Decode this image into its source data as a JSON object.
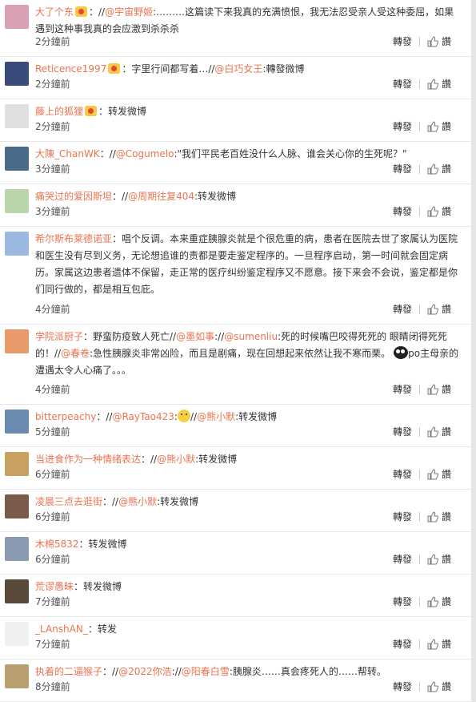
{
  "repost_label": "轉發",
  "like_label": "讚",
  "comments": [
    {
      "name": "大了个东",
      "badge": true,
      "parts": [
        {
          "t": "：//"
        },
        {
          "t": "@宇宙野姬",
          "m": true
        },
        {
          "t": ":………这篇读下来我真的充满愤恨，我无法忍受亲人受这种委屈，如果遇到这种事我真的会应激到杀杀杀"
        }
      ],
      "time": "2分鐘前",
      "avatar_color": "#d8a0b4"
    },
    {
      "name": "Reticence1997",
      "badge": true,
      "parts": [
        {
          "t": "：字里行间都写着…//"
        },
        {
          "t": "@白巧女王",
          "m": true
        },
        {
          "t": ":轉發微博"
        }
      ],
      "time": "2分鐘前",
      "avatar_color": "#3a4a7a"
    },
    {
      "name": "藤上的狐狸",
      "badge": true,
      "parts": [
        {
          "t": "：转发微博"
        }
      ],
      "time": "2分鐘前",
      "avatar_color": "#e0e0e0"
    },
    {
      "name": "大陳_ChanWK",
      "badge": false,
      "parts": [
        {
          "t": "：//"
        },
        {
          "t": "@Cogumelo",
          "m": true
        },
        {
          "t": ":\"我们平民老百姓没什么人脉、谁会关心你的生死呢？\""
        }
      ],
      "time": "3分鐘前",
      "avatar_color": "#4a6b8a"
    },
    {
      "name": "痛哭过的爱因斯坦",
      "badge": false,
      "parts": [
        {
          "t": "：//"
        },
        {
          "t": "@周期往复404",
          "m": true
        },
        {
          "t": ":转发微博"
        }
      ],
      "time": "3分鐘前",
      "avatar_color": "#b8d4a8"
    },
    {
      "name": "希尔斯布莱德诺亚",
      "badge": false,
      "parts": [
        {
          "t": "：唱个反调。本来重症胰腺炎就是个很危重的病，患者在医院去世了家属认为医院和医生没有尽到义务，无论想追谁的责都是要走鉴定程序的。一旦程序启动，第一时间就会固定病历。家属这边患者遗体不保留，走正常的医疗纠纷鉴定程序又不愿意。接下来会不会说，鉴定都是你们同行做的，都是相互包庇。"
        }
      ],
      "time": "4分鐘前",
      "avatar_color": "#9ab8e0"
    },
    {
      "name": "学院派厨子",
      "badge": false,
      "parts": [
        {
          "t": "：野蛮防疫致人死亡//"
        },
        {
          "t": "@墨如事",
          "m": true
        },
        {
          "t": ":"
        },
        {
          "t": "//"
        },
        {
          "t": "@sumenliu",
          "m": true
        },
        {
          "t": ":死的时候嘴巴咬得死死的 眼睛闭得死死的！//"
        },
        {
          "t": "@春卷",
          "m": true
        },
        {
          "t": ":急性胰腺炎非常凶险，而且是剧痛，现在回想起来依然让我不寒而栗。"
        },
        {
          "ghost": true
        },
        {
          "t": "po主母亲的遭遇太令人心痛了。。。"
        }
      ],
      "time": "4分鐘前",
      "avatar_color": "#e89a6a"
    },
    {
      "name": "bitterpeachy",
      "badge": false,
      "parts": [
        {
          "t": "：//"
        },
        {
          "t": "@RayTao423",
          "m": true
        },
        {
          "t": ":"
        },
        {
          "emoji": true
        },
        {
          "t": "//"
        },
        {
          "t": "@熊小默",
          "m": true
        },
        {
          "t": ":转发微博"
        }
      ],
      "time": "5分鐘前",
      "avatar_color": "#6a8ab0"
    },
    {
      "name": "当进食作为一种情绪表达",
      "badge": false,
      "parts": [
        {
          "t": "：//"
        },
        {
          "t": "@熊小默",
          "m": true
        },
        {
          "t": ":转发微博"
        }
      ],
      "time": "6分鐘前",
      "avatar_color": "#c8a060"
    },
    {
      "name": "凌晨三点去逛街",
      "badge": false,
      "parts": [
        {
          "t": "：//"
        },
        {
          "t": "@熊小默",
          "m": true
        },
        {
          "t": ":转发微博"
        }
      ],
      "time": "6分鐘前",
      "avatar_color": "#7a5a4a"
    },
    {
      "name": "木棉5832",
      "badge": false,
      "parts": [
        {
          "t": "：转发微博"
        }
      ],
      "time": "6分鐘前",
      "avatar_color": "#8a9ab0"
    },
    {
      "name": "荒谬愚昧",
      "badge": false,
      "parts": [
        {
          "t": "：转发微博"
        }
      ],
      "time": "7分鐘前",
      "avatar_color": "#5a4a3a"
    },
    {
      "name": "_LAnshAN_",
      "badge": false,
      "parts": [
        {
          "t": "：转发"
        }
      ],
      "time": "7分鐘前",
      "avatar_color": "#f0f0f0"
    },
    {
      "name": "执着的二逼猴子",
      "badge": false,
      "parts": [
        {
          "t": "：//"
        },
        {
          "t": "@2022你浩",
          "m": true
        },
        {
          "t": ":"
        },
        {
          "t": "//"
        },
        {
          "t": "@阳春白雪",
          "m": true
        },
        {
          "t": ":胰腺炎……真会疼死人的……帮转。"
        }
      ],
      "time": "8分鐘前",
      "avatar_color": "#b8a070"
    }
  ]
}
